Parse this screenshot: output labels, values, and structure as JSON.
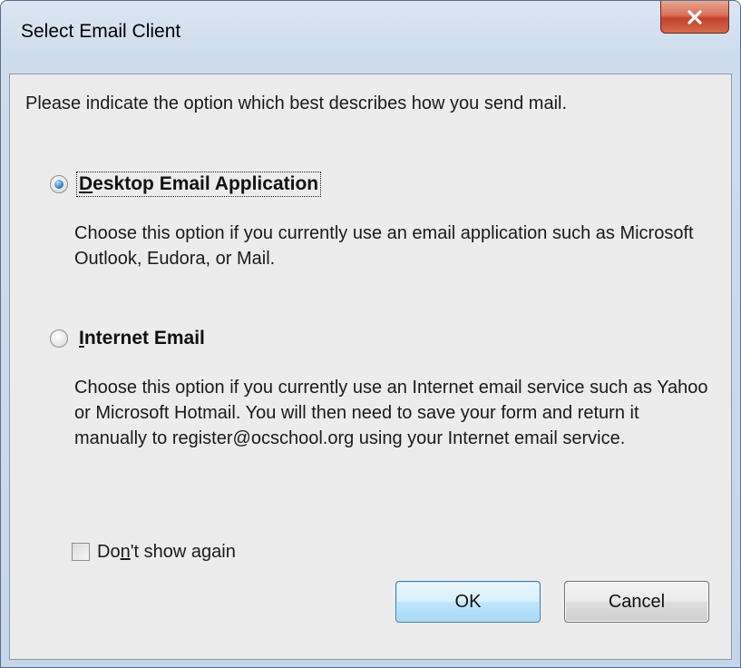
{
  "window": {
    "title": "Select Email Client",
    "close_icon": "close-icon"
  },
  "prompt": "Please indicate the option which best describes how you send mail.",
  "options": [
    {
      "label_pre": "",
      "label_underlined": "D",
      "label_post": "esktop Email Application",
      "description": "Choose this option if you currently use an email application such as Microsoft Outlook, Eudora, or Mail.",
      "selected": true
    },
    {
      "label_pre": "",
      "label_underlined": "I",
      "label_post": "nternet Email",
      "description": "Choose this option if you currently use an Internet email service such as Yahoo or Microsoft Hotmail. You will then need to save your form and return it manually to register@ocschool.org using your Internet email service.",
      "selected": false
    }
  ],
  "dont_show": {
    "label_pre": "Do",
    "label_underlined": "n",
    "label_post": "'t show again",
    "checked": false
  },
  "buttons": {
    "ok": "OK",
    "cancel": "Cancel"
  },
  "colors": {
    "accent": "#3c7fb1",
    "close": "#c3412a"
  }
}
